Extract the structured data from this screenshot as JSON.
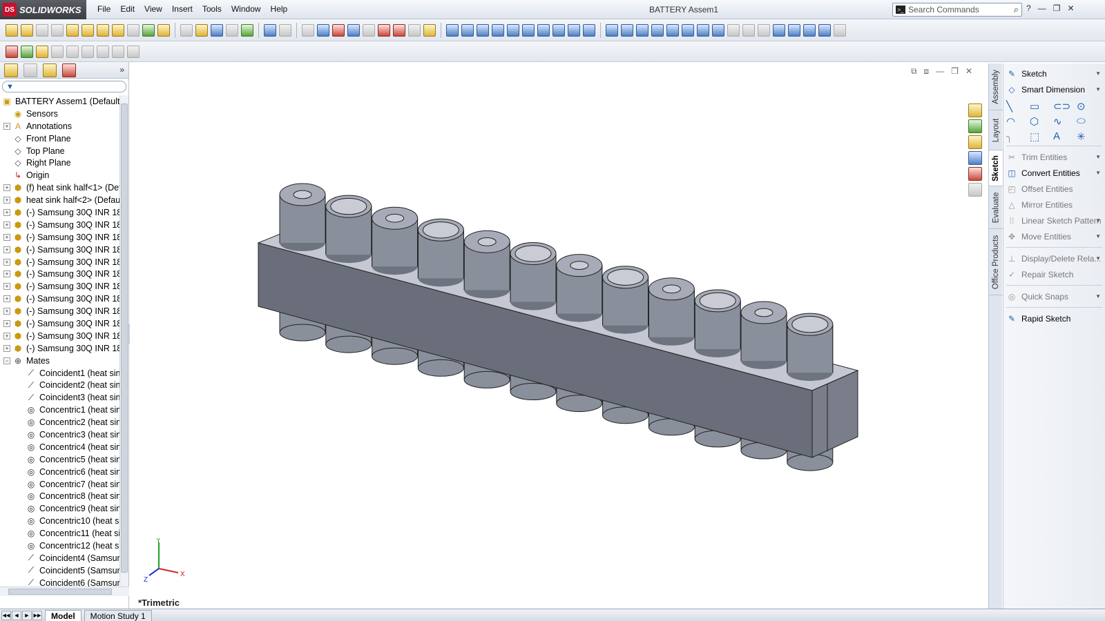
{
  "app": {
    "name": "SOLIDWORKS",
    "ds": "DS"
  },
  "menu": [
    "File",
    "Edit",
    "View",
    "Insert",
    "Tools",
    "Window",
    "Help"
  ],
  "doc_title": "BATTERY Assem1",
  "search": {
    "placeholder": "Search Commands"
  },
  "tree": {
    "root": "BATTERY Assem1  (Default<",
    "items": [
      {
        "label": "Sensors",
        "icon": "sensor-icon",
        "exp": ""
      },
      {
        "label": "Annotations",
        "icon": "annotations-icon",
        "exp": "+"
      },
      {
        "label": "Front Plane",
        "icon": "plane-icon",
        "exp": ""
      },
      {
        "label": "Top Plane",
        "icon": "plane-icon",
        "exp": ""
      },
      {
        "label": "Right Plane",
        "icon": "plane-icon",
        "exp": ""
      },
      {
        "label": "Origin",
        "icon": "origin-icon",
        "exp": ""
      },
      {
        "label": "(f) heat sink half<1> (Def",
        "icon": "part-icon",
        "exp": "+"
      },
      {
        "label": "heat sink half<2> (Defau",
        "icon": "part-icon",
        "exp": "+"
      },
      {
        "label": "(-) Samsung 30Q INR 186",
        "icon": "part-icon",
        "exp": "+"
      },
      {
        "label": "(-) Samsung 30Q INR 186",
        "icon": "part-icon",
        "exp": "+"
      },
      {
        "label": "(-) Samsung 30Q INR 186",
        "icon": "part-icon",
        "exp": "+"
      },
      {
        "label": "(-) Samsung 30Q INR 186",
        "icon": "part-icon",
        "exp": "+"
      },
      {
        "label": "(-) Samsung 30Q INR 186",
        "icon": "part-icon",
        "exp": "+"
      },
      {
        "label": "(-) Samsung 30Q INR 186",
        "icon": "part-icon",
        "exp": "+"
      },
      {
        "label": "(-) Samsung 30Q INR 186",
        "icon": "part-icon",
        "exp": "+"
      },
      {
        "label": "(-) Samsung 30Q INR 186",
        "icon": "part-icon",
        "exp": "+"
      },
      {
        "label": "(-) Samsung 30Q INR 186",
        "icon": "part-icon",
        "exp": "+"
      },
      {
        "label": "(-) Samsung 30Q INR 186",
        "icon": "part-icon",
        "exp": "+"
      },
      {
        "label": "(-) Samsung 30Q INR 186",
        "icon": "part-icon",
        "exp": "+"
      },
      {
        "label": "(-) Samsung 30Q INR 186",
        "icon": "part-icon",
        "exp": "+"
      },
      {
        "label": "Mates",
        "icon": "mates-icon",
        "exp": "−"
      }
    ],
    "mates": [
      {
        "label": "Coincident1 (heat sin",
        "icon": "coincident-icon"
      },
      {
        "label": "Coincident2 (heat sin",
        "icon": "coincident-icon"
      },
      {
        "label": "Coincident3 (heat sin",
        "icon": "coincident-icon"
      },
      {
        "label": "Concentric1 (heat sin",
        "icon": "concentric-icon"
      },
      {
        "label": "Concentric2 (heat sin",
        "icon": "concentric-icon"
      },
      {
        "label": "Concentric3 (heat sin",
        "icon": "concentric-icon"
      },
      {
        "label": "Concentric4 (heat sin",
        "icon": "concentric-icon"
      },
      {
        "label": "Concentric5 (heat sin",
        "icon": "concentric-icon"
      },
      {
        "label": "Concentric6 (heat sin",
        "icon": "concentric-icon"
      },
      {
        "label": "Concentric7 (heat sin",
        "icon": "concentric-icon"
      },
      {
        "label": "Concentric8 (heat sin",
        "icon": "concentric-icon"
      },
      {
        "label": "Concentric9 (heat sin",
        "icon": "concentric-icon"
      },
      {
        "label": "Concentric10 (heat si",
        "icon": "concentric-icon"
      },
      {
        "label": "Concentric11 (heat si",
        "icon": "concentric-icon"
      },
      {
        "label": "Concentric12 (heat si",
        "icon": "concentric-icon"
      },
      {
        "label": "Coincident4 (Samsur",
        "icon": "coincident-icon"
      },
      {
        "label": "Coincident5 (Samsur",
        "icon": "coincident-icon"
      },
      {
        "label": "Coincident6 (Samsur",
        "icon": "coincident-icon"
      }
    ]
  },
  "vtabs": [
    "Assembly",
    "Layout",
    "Sketch",
    "Evaluate",
    "Office Products"
  ],
  "command_manager": {
    "sketch": "Sketch",
    "smart_dimension": "Smart Dimension",
    "trim": "Trim Entities",
    "convert": "Convert Entities",
    "offset": "Offset Entities",
    "mirror": "Mirror Entities",
    "linear_pattern": "Linear Sketch Pattern",
    "move": "Move Entities",
    "display_delete": "Display/Delete Rela...",
    "repair": "Repair Sketch",
    "quick_snaps": "Quick Snaps",
    "rapid_sketch": "Rapid Sketch"
  },
  "viewport": {
    "view_label": "*Trimetric",
    "axis_x": "X",
    "axis_y": "Y",
    "axis_z": "Z",
    "cell_count": 12
  },
  "bottom_tabs": [
    "Model",
    "Motion Study 1"
  ],
  "colors": {
    "cell": "#8a8f9c",
    "cell_dark": "#6e7380",
    "heatsink_top": "#c5c8d2",
    "heatsink_front": "#6a6e7a"
  }
}
